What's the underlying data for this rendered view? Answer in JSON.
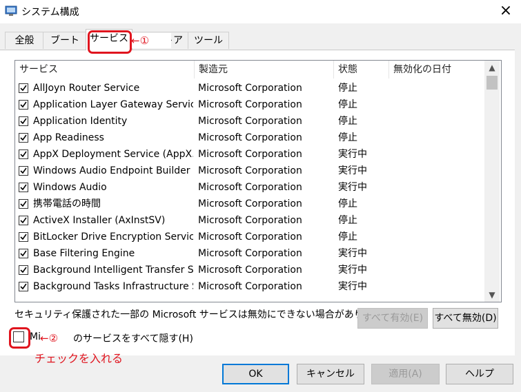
{
  "window": {
    "title": "システム構成"
  },
  "tabs": [
    "全般",
    "ブート",
    "サービス",
    "スタートアップ",
    "ツール"
  ],
  "annotations": {
    "tab_note": "←①",
    "checkbox_note": "←②",
    "instruction": "チェックを入れる"
  },
  "list": {
    "headers": {
      "service": "サービス",
      "manufacturer": "製造元",
      "status": "状態",
      "disabled_date": "無効化の日付"
    },
    "rows": [
      {
        "name": "AllJoyn Router Service",
        "manufacturer": "Microsoft Corporation",
        "status": "停止",
        "checked": true
      },
      {
        "name": "Application Layer Gateway Service",
        "manufacturer": "Microsoft Corporation",
        "status": "停止",
        "checked": true
      },
      {
        "name": "Application Identity",
        "manufacturer": "Microsoft Corporation",
        "status": "停止",
        "checked": true
      },
      {
        "name": "App Readiness",
        "manufacturer": "Microsoft Corporation",
        "status": "停止",
        "checked": true
      },
      {
        "name": "AppX Deployment Service (AppX...",
        "manufacturer": "Microsoft Corporation",
        "status": "実行中",
        "checked": true
      },
      {
        "name": "Windows Audio Endpoint Builder",
        "manufacturer": "Microsoft Corporation",
        "status": "実行中",
        "checked": true
      },
      {
        "name": "Windows Audio",
        "manufacturer": "Microsoft Corporation",
        "status": "実行中",
        "checked": true
      },
      {
        "name": "携帯電話の時間",
        "manufacturer": "Microsoft Corporation",
        "status": "停止",
        "checked": true
      },
      {
        "name": "ActiveX Installer (AxInstSV)",
        "manufacturer": "Microsoft Corporation",
        "status": "停止",
        "checked": true
      },
      {
        "name": "BitLocker Drive Encryption Service",
        "manufacturer": "Microsoft Corporation",
        "status": "停止",
        "checked": true
      },
      {
        "name": "Base Filtering Engine",
        "manufacturer": "Microsoft Corporation",
        "status": "実行中",
        "checked": true
      },
      {
        "name": "Background Intelligent Transfer S...",
        "manufacturer": "Microsoft Corporation",
        "status": "実行中",
        "checked": true
      },
      {
        "name": "Background Tasks Infrastructure S...",
        "manufacturer": "Microsoft Corporation",
        "status": "実行中",
        "checked": true
      }
    ]
  },
  "note": "セキュリティ保護された一部の Microsoft サービスは無効にできない場合があります。",
  "buttons": {
    "enable_all": "すべて有効(E)",
    "disable_all": "すべて無効(D)",
    "ok": "OK",
    "cancel": "キャンセル",
    "apply": "適用(A)",
    "help": "ヘルプ"
  },
  "hide_ms": {
    "label_a": "Mi",
    "label_b": "のサービスをすべて隠す(H)",
    "checked": false
  },
  "icons": {
    "close": "×",
    "scroll_up": "▲",
    "scroll_down": "▼"
  }
}
